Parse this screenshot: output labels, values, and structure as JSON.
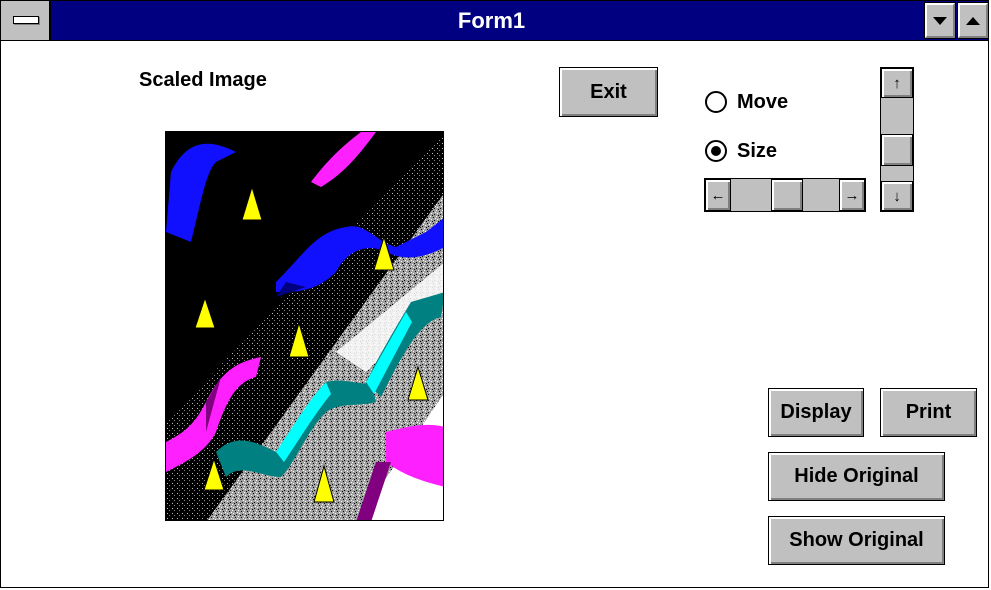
{
  "window": {
    "title": "Form1"
  },
  "labels": {
    "scaled_image": "Scaled Image"
  },
  "buttons": {
    "exit": "Exit",
    "display": "Display",
    "print": "Print",
    "hide_original": "Hide Original",
    "show_original": "Show Original"
  },
  "radios": {
    "move": {
      "label": "Move",
      "checked": false
    },
    "size": {
      "label": "Size",
      "checked": true
    }
  },
  "icons": {
    "system_menu": "system-menu-icon",
    "minimize": "minimize-icon",
    "maximize": "maximize-icon",
    "arrow_left": "←",
    "arrow_right": "→",
    "arrow_up": "↑",
    "arrow_down": "↓"
  },
  "colors": {
    "titlebar": "#000080",
    "button_face": "#c0c0c0",
    "ribbon_blue": "#1010ff",
    "ribbon_magenta": "#ff20ff",
    "ribbon_teal": "#008080",
    "ribbon_cyan": "#00ffff",
    "ribbon_purple": "#800080",
    "cone_yellow": "#ffff00"
  }
}
